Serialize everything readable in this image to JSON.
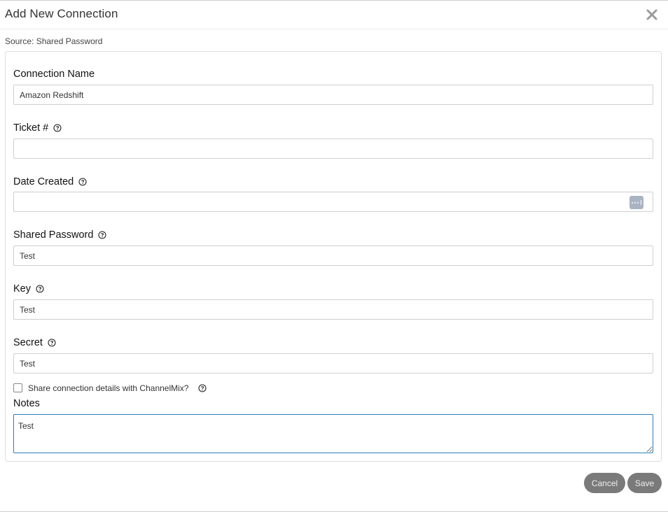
{
  "dialog": {
    "title": "Add New Connection",
    "source": "Source: Shared Password"
  },
  "fields": {
    "connection_name": {
      "label": "Connection Name",
      "value": "Amazon Redshift"
    },
    "ticket": {
      "label": "Ticket #",
      "value": ""
    },
    "date_created": {
      "label": "Date Created",
      "value": ""
    },
    "shared_password": {
      "label": "Shared Password",
      "value": "Test"
    },
    "key": {
      "label": "Key",
      "value": "Test"
    },
    "secret": {
      "label": "Secret",
      "value": "Test"
    }
  },
  "share": {
    "label": "Share connection details with ChannelMix?",
    "checked": false
  },
  "notes": {
    "label": "Notes",
    "value": "Test"
  },
  "buttons": {
    "cancel": "Cancel",
    "save": "Save"
  },
  "icons": {
    "close": "close-icon",
    "help": "question-circle-icon",
    "date_picker": "ellipsis-calendar-icon"
  },
  "colors": {
    "button_bg": "#7a7a7a",
    "focus_border": "#2e7db8",
    "date_button": "#a9b3c2"
  }
}
